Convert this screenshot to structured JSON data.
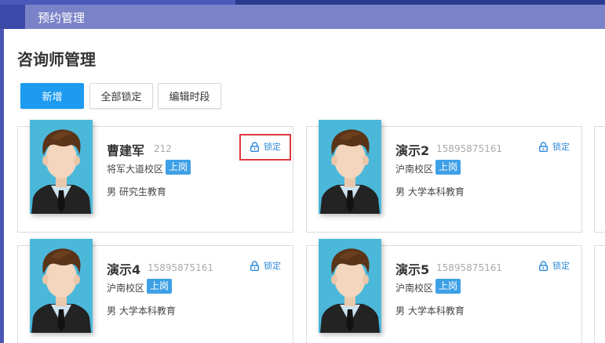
{
  "tab": {
    "label": "预约管理"
  },
  "page": {
    "title": "咨询师管理"
  },
  "toolbar": {
    "add_label": "新增",
    "lock_all_label": "全部锁定",
    "edit_slots_label": "编辑时段"
  },
  "lock_label": "锁定",
  "colors": {
    "primary": "#1d9bf0",
    "badge": "#3ea0e6",
    "highlight": "#e0383e",
    "header": "#7b83c8"
  },
  "counselors": [
    {
      "name": "曹建军",
      "phone": "212",
      "campus": "将军大道校区",
      "status": "上岗",
      "gender": "男",
      "education": "研究生教育"
    },
    {
      "name": "演示2",
      "phone": "15895875161",
      "campus": "沪南校区",
      "status": "上岗",
      "gender": "男",
      "education": "大学本科教育"
    },
    {
      "name": "演示4",
      "phone": "15895875161",
      "campus": "沪南校区",
      "status": "上岗",
      "gender": "男",
      "education": "大学本科教育"
    },
    {
      "name": "演示5",
      "phone": "15895875161",
      "campus": "沪南校区",
      "status": "上岗",
      "gender": "男",
      "education": "大学本科教育"
    }
  ]
}
